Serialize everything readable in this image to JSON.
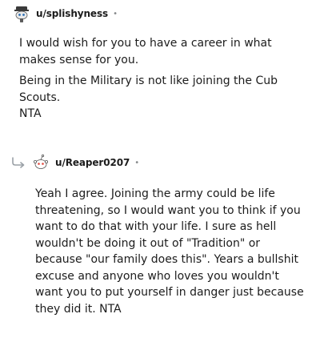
{
  "comments": [
    {
      "username": "u/splishyness",
      "separator": "•",
      "avatar_icon": "snoo-avatar-icon",
      "paragraphs": [
        "I would wish for you to have a career in what makes sense for you.",
        "Being in the Military is not like joining the Cub Scouts.",
        "NTA"
      ]
    },
    {
      "username": "u/Reaper0207",
      "separator": "•",
      "avatar_icon": "snoo-avatar-icon",
      "reply_icon": "reply-arrow-icon",
      "paragraphs": [
        "Yeah I agree. Joining the army could be life threatening, so I would want you to think if you want to do that with your life. I sure as hell wouldn't be doing it out of \"Tradition\" or because \"our family does this\". Years a bullshit excuse and anyone who loves you wouldn't want you to put yourself in danger just because they did it. NTA"
      ]
    }
  ]
}
